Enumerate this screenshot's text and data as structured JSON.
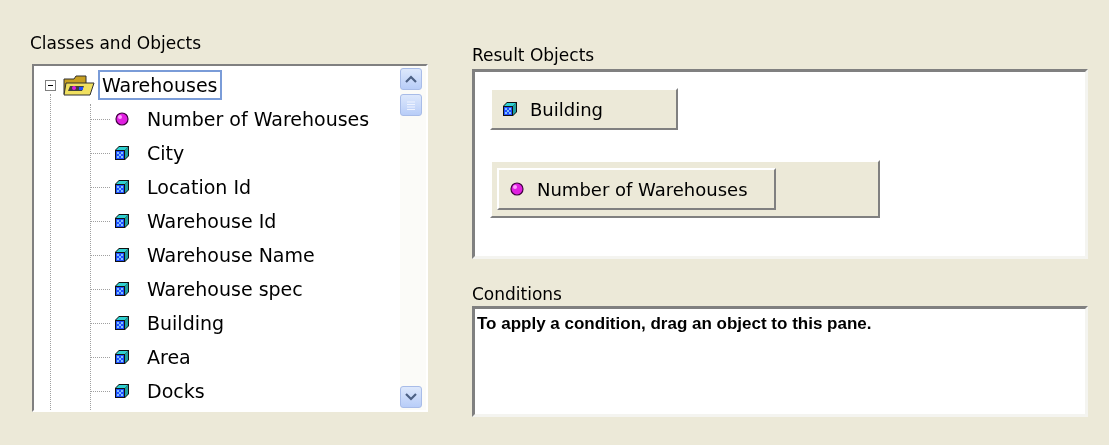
{
  "classes_and_objects": {
    "label": "Classes and Objects",
    "tree": [
      {
        "label": "Warehouses",
        "kind": "class",
        "expanded": true,
        "selected": true,
        "children": [
          {
            "label": "Number of Warehouses",
            "kind": "measure",
            "selected": false
          },
          {
            "label": "City",
            "kind": "dimension",
            "selected": false
          },
          {
            "label": "Location Id",
            "kind": "dimension",
            "selected": false
          },
          {
            "label": "Warehouse Id",
            "kind": "dimension",
            "selected": false
          },
          {
            "label": "Warehouse Name",
            "kind": "dimension",
            "selected": false
          },
          {
            "label": "Warehouse spec",
            "kind": "dimension",
            "selected": false
          },
          {
            "label": "Building",
            "kind": "dimension",
            "selected": false
          },
          {
            "label": "Area",
            "kind": "dimension",
            "selected": false
          },
          {
            "label": "Docks",
            "kind": "dimension",
            "selected": false
          }
        ]
      }
    ]
  },
  "result_objects": {
    "label": "Result Objects",
    "items": [
      {
        "label": "Building",
        "kind": "dimension",
        "grouped": false
      },
      {
        "label": "Number of Warehouses",
        "kind": "measure",
        "grouped": true
      }
    ]
  },
  "conditions": {
    "label": "Conditions",
    "hint": "To apply a condition, drag an object to this pane."
  }
}
